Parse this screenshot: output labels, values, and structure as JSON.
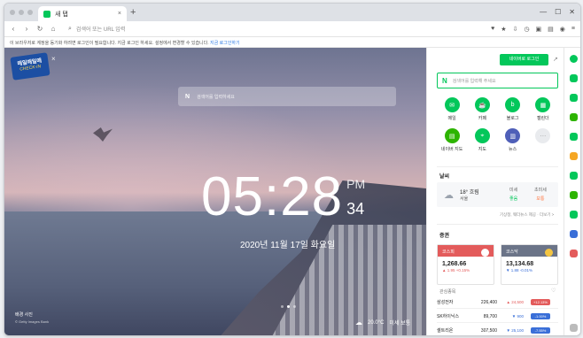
{
  "browser": {
    "tab_title": "새 탭",
    "tab_close": "×",
    "new_tab": "+",
    "address_placeholder": "검색어 또는 URL 입력",
    "toolbar_icons": [
      "bookmark-icon",
      "star-icon",
      "download-icon",
      "history-icon",
      "extensions-icon",
      "sidebar-icon",
      "profile-icon",
      "menu-icon"
    ],
    "infobar_text": "이 브라우저로 계정을 동기화 하려면 로그인이 필요합니다. 지금 로그인 하세요. 설정에서 변경할 수 있습니다.",
    "infobar_link": "지금 로그인하기"
  },
  "hero": {
    "checkin_line1": "매일매일매",
    "checkin_line2": "CHECK-IN",
    "search_placeholder": "검색어를 입력하세요",
    "search_brand": "N",
    "time": "05:28",
    "ampm": "PM",
    "seconds": "34",
    "date": "2020년 11월 17일 화요일",
    "credit_title": "배경 사진",
    "credit_sub": "© Getty Images Bank",
    "weather_temp": "20.0°C",
    "weather_extra": "미세 보통"
  },
  "panel": {
    "login_label": "네이버로 로그인",
    "search_brand": "N",
    "search_placeholder": "검색어를 입력해 주세요",
    "shortcuts": [
      {
        "label": "메일",
        "color": "#03c75a",
        "icon": "mail-icon"
      },
      {
        "label": "카페",
        "color": "#03c75a",
        "icon": "cafe-icon"
      },
      {
        "label": "블로그",
        "color": "#03c75a",
        "icon": "blog-icon"
      },
      {
        "label": "캘린더",
        "color": "#03c75a",
        "icon": "calendar-icon"
      },
      {
        "label": "네이버 지도",
        "color": "#2db400",
        "icon": "map-icon"
      },
      {
        "label": "지도",
        "color": "#03c75a",
        "icon": "pin-icon"
      },
      {
        "label": "뉴스",
        "color": "#4f5fb8",
        "icon": "news-icon"
      },
      {
        "label": "",
        "color": "#e9ebee",
        "icon": "more-icon"
      }
    ],
    "weather_title": "날씨",
    "weather": {
      "temp": "18° 흐림",
      "location": "서울",
      "dust_label1": "미세",
      "dust_value1": "좋음",
      "dust_label2": "초미세",
      "dust_value2": "보통",
      "links": "기상청, 웨더뉴스 제공  ·  더보기 >"
    },
    "finance_title": "증권",
    "indices": [
      {
        "name": "코스피",
        "value": "1,268.66",
        "change": "▲ 1.95 +0.15%",
        "head_color": "#e35b5b",
        "change_color": "#e35b5b"
      },
      {
        "name": "코스닥",
        "value": "13,134.68",
        "change": "▼ 1.88 -0.01%",
        "head_color": "#6b7488",
        "change_color": "#3a6fd8"
      }
    ],
    "watch_label": "관심종목",
    "watch_right": "♡",
    "stocks": [
      {
        "name": "삼성전자",
        "price": "226,400",
        "change": "▲ 24,500",
        "pct": "+12.13%",
        "pct_color": "#e35b5b",
        "change_color": "#e35b5b"
      },
      {
        "name": "SK하이닉스",
        "price": "89,700",
        "change": "▼ 900",
        "pct": "-1.00%",
        "pct_color": "#3a6fd8",
        "change_color": "#3a6fd8"
      },
      {
        "name": "셀트리온",
        "price": "307,500",
        "change": "▼ 25,100",
        "pct": "-7.55%",
        "pct_color": "#3a6fd8",
        "change_color": "#3a6fd8"
      }
    ]
  },
  "sidebar": {
    "icons": [
      {
        "icon": "add-icon",
        "color": "#03c75a"
      },
      {
        "icon": "naver-icon",
        "color": "#03c75a"
      },
      {
        "icon": "mail-icon",
        "color": "#03c75a"
      },
      {
        "icon": "calendar-icon",
        "color": "#2db400"
      },
      {
        "icon": "cafe-icon",
        "color": "#03c75a"
      },
      {
        "icon": "book-icon",
        "color": "#f5a623"
      },
      {
        "icon": "memo-icon",
        "color": "#03c75a"
      },
      {
        "icon": "translate-icon",
        "color": "#2db400"
      },
      {
        "icon": "clock-icon",
        "color": "#03c75a"
      },
      {
        "icon": "tv-icon",
        "color": "#3a6fd8"
      },
      {
        "icon": "shop-icon",
        "color": "#e35b5b"
      },
      {
        "icon": "settings-icon",
        "color": "#888888"
      }
    ]
  }
}
